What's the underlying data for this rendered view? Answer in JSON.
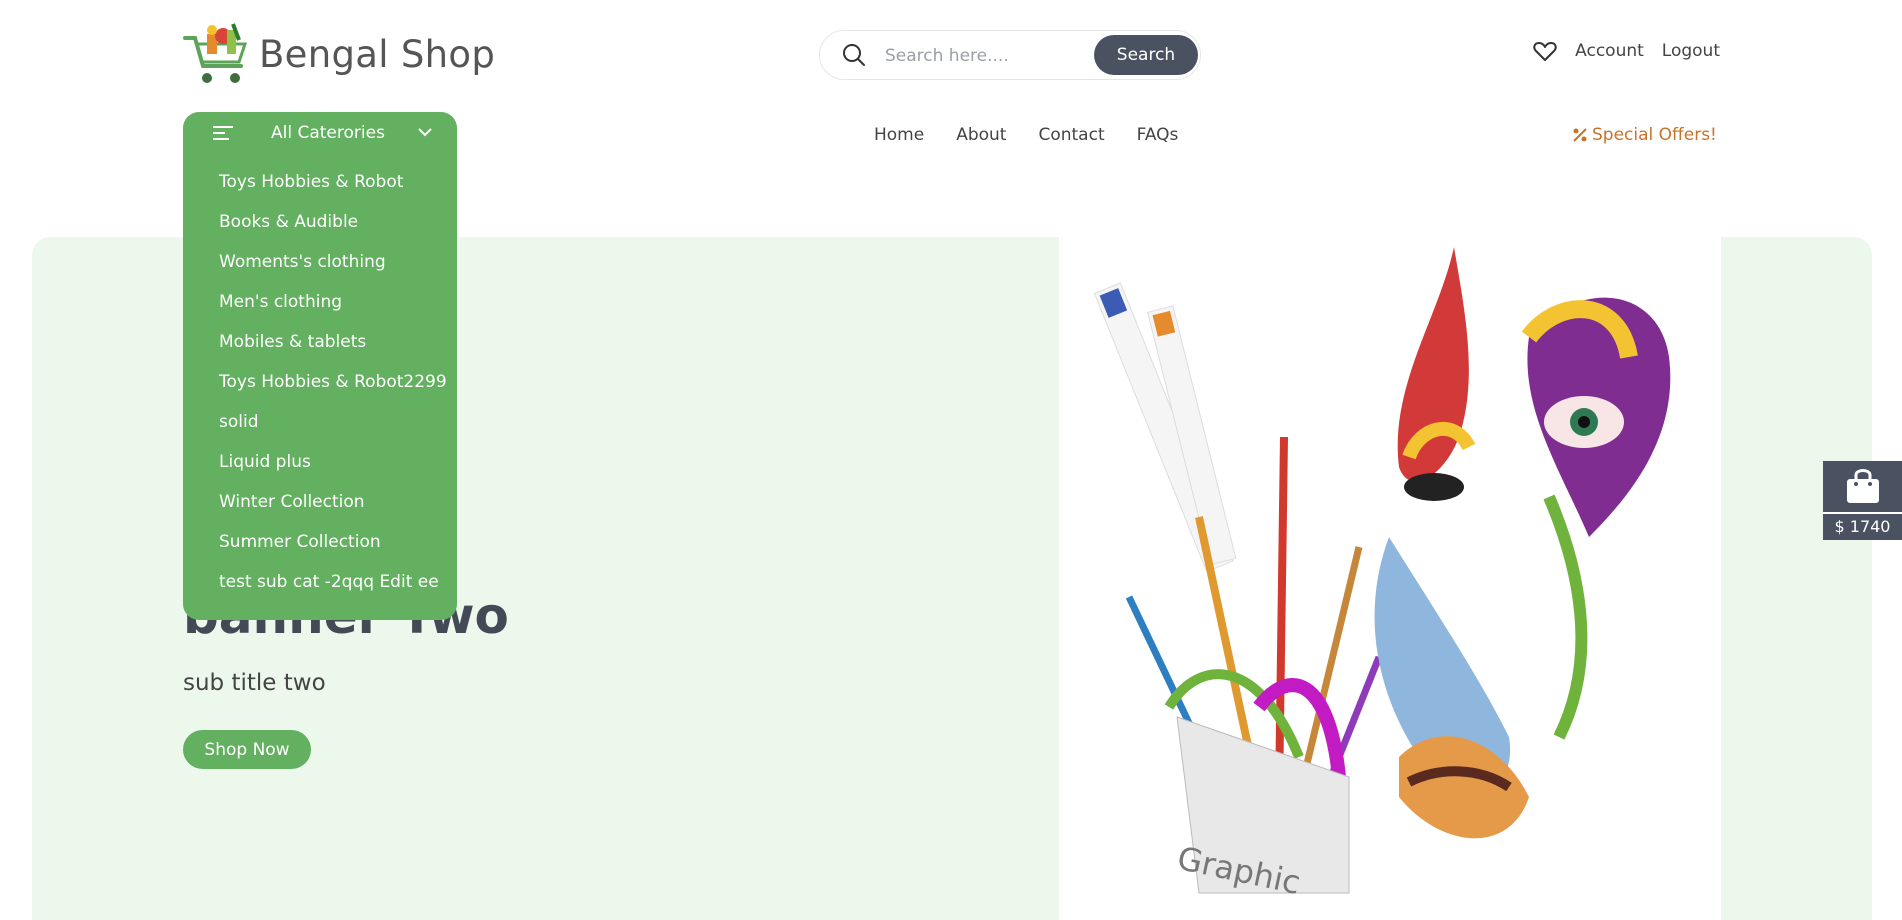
{
  "brand": {
    "name": "Bengal Shop",
    "accent": "#63b061",
    "dark": "#4a5160",
    "offer_color": "#c8732a"
  },
  "search": {
    "placeholder": "Search here....",
    "button": "Search"
  },
  "top_links": {
    "account": "Account",
    "logout": "Logout"
  },
  "categories": {
    "title": "All Caterories",
    "items": [
      "Toys Hobbies & Robot",
      "Books & Audible",
      "Woments's clothing",
      "Men's clothing",
      "Mobiles & tablets",
      "Toys Hobbies & Robot2299",
      "solid",
      "Liquid plus",
      "Winter Collection",
      "Summer Collection",
      "test sub cat -2qqq Edit ee"
    ]
  },
  "nav": {
    "home": "Home",
    "about": "About",
    "contact": "Contact",
    "faqs": "FAQs",
    "offers": "Special Offers!"
  },
  "banner": {
    "title": "banner Two",
    "subtitle": "sub title two",
    "button": "Shop Now",
    "image_text": "Graphic"
  },
  "cart": {
    "total": "$ 1740"
  }
}
